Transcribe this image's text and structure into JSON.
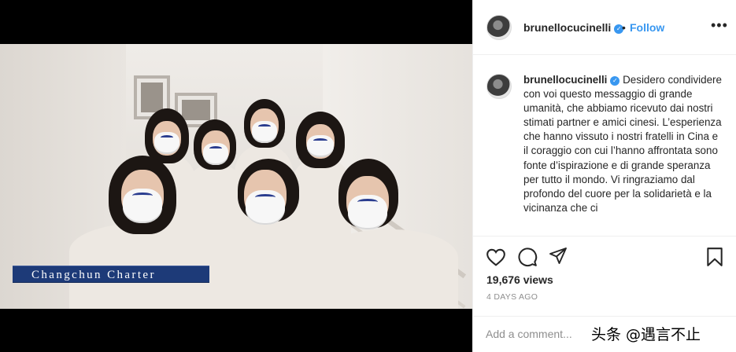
{
  "post": {
    "username": "brunellocucinelli",
    "verified_icon": "verified-badge-icon",
    "bullet": "•",
    "follow_label": "Follow",
    "more_label": "•••",
    "caption": "Desidero condividere con voi questo messaggio di grande umanità, che abbiamo ricevuto dai nostri stimati partner e amici cinesi. L’esperienza che hanno vissuto i nostri fratelli in Cina e il coraggio con cui l’hanno affrontata sono fonte d’ispirazione e di grande speranza per tutto il mondo. Vi ringraziamo dal profondo del cuore per la solidarietà e la vicinanza che ci",
    "views": "19,676 views",
    "time_ago": "4 DAYS AGO",
    "comment_placeholder": "Add a comment..."
  },
  "video": {
    "caption_text": "Changchun Charter"
  },
  "overlay": {
    "watermark": "头条 @遇言不止"
  },
  "icons": {
    "like": "heart-icon",
    "comment": "comment-icon",
    "share": "share-icon",
    "save": "bookmark-icon",
    "more": "more-options-icon"
  },
  "colors": {
    "link": "#3897f0",
    "caption_band": "#1d3a78",
    "muted": "#8e8e8e"
  }
}
